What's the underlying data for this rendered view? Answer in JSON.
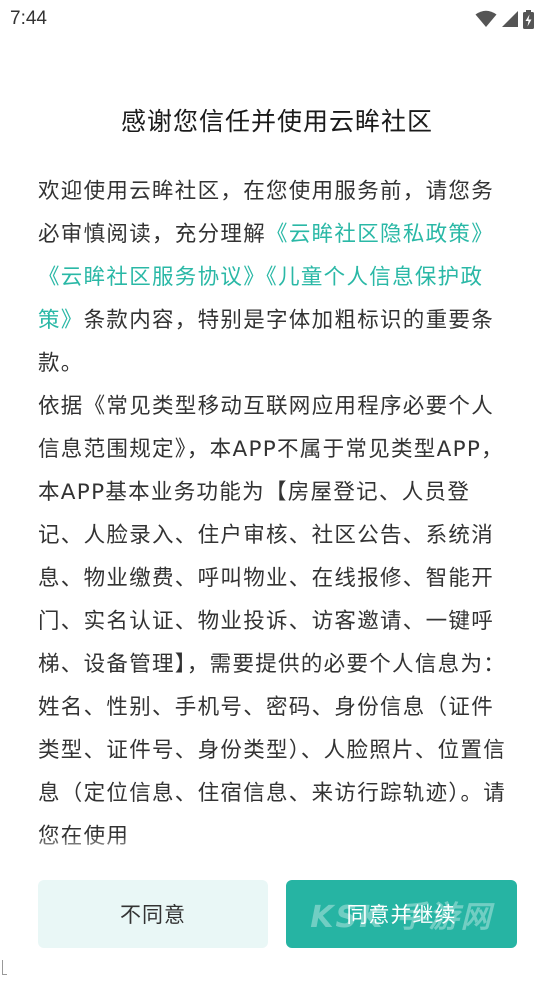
{
  "status_bar": {
    "time": "7:44",
    "icons": [
      "wifi-icon",
      "cellular-signal-icon",
      "battery-charging-icon"
    ]
  },
  "dialog": {
    "title": "感谢您信任并使用云眸社区",
    "paragraph1": {
      "intro": "欢迎使用云眸社区，在您使用服务前，请您务必审慎阅读，充分理解",
      "link_privacy": "《云眸社区隐私政策》",
      "link_service": "《云眸社区服务协议》",
      "link_children": "《儿童个人信息保护政策》",
      "outro": "条款内容，特别是字体加粗标识的重要条款。"
    },
    "paragraph2": "依据《常见类型移动互联网应用程序必要个人信息范围规定》，本APP不属于常见类型APP，本APP基本业务功能为【房屋登记、人员登记、人脸录入、住户审核、社区公告、系统消息、物业缴费、呼叫物业、在线报修、智能开门、实名认证、物业投诉、访客邀请、一键呼梯、设备管理】，需要提供的必要个人信息为：姓名、性别、手机号、密码、身份信息（证件类型、证件号、身份类型）、人脸照片、位置信息（定位信息、住宿信息、来访行踪轨迹）。请您在使用",
    "buttons": {
      "disagree": "不同意",
      "agree": "同意并继续"
    }
  },
  "watermark": "KSK 手游网",
  "colors": {
    "link": "#2ab8a6",
    "agree_button": "#26b4a3",
    "disagree_button": "#e9f7f6"
  }
}
